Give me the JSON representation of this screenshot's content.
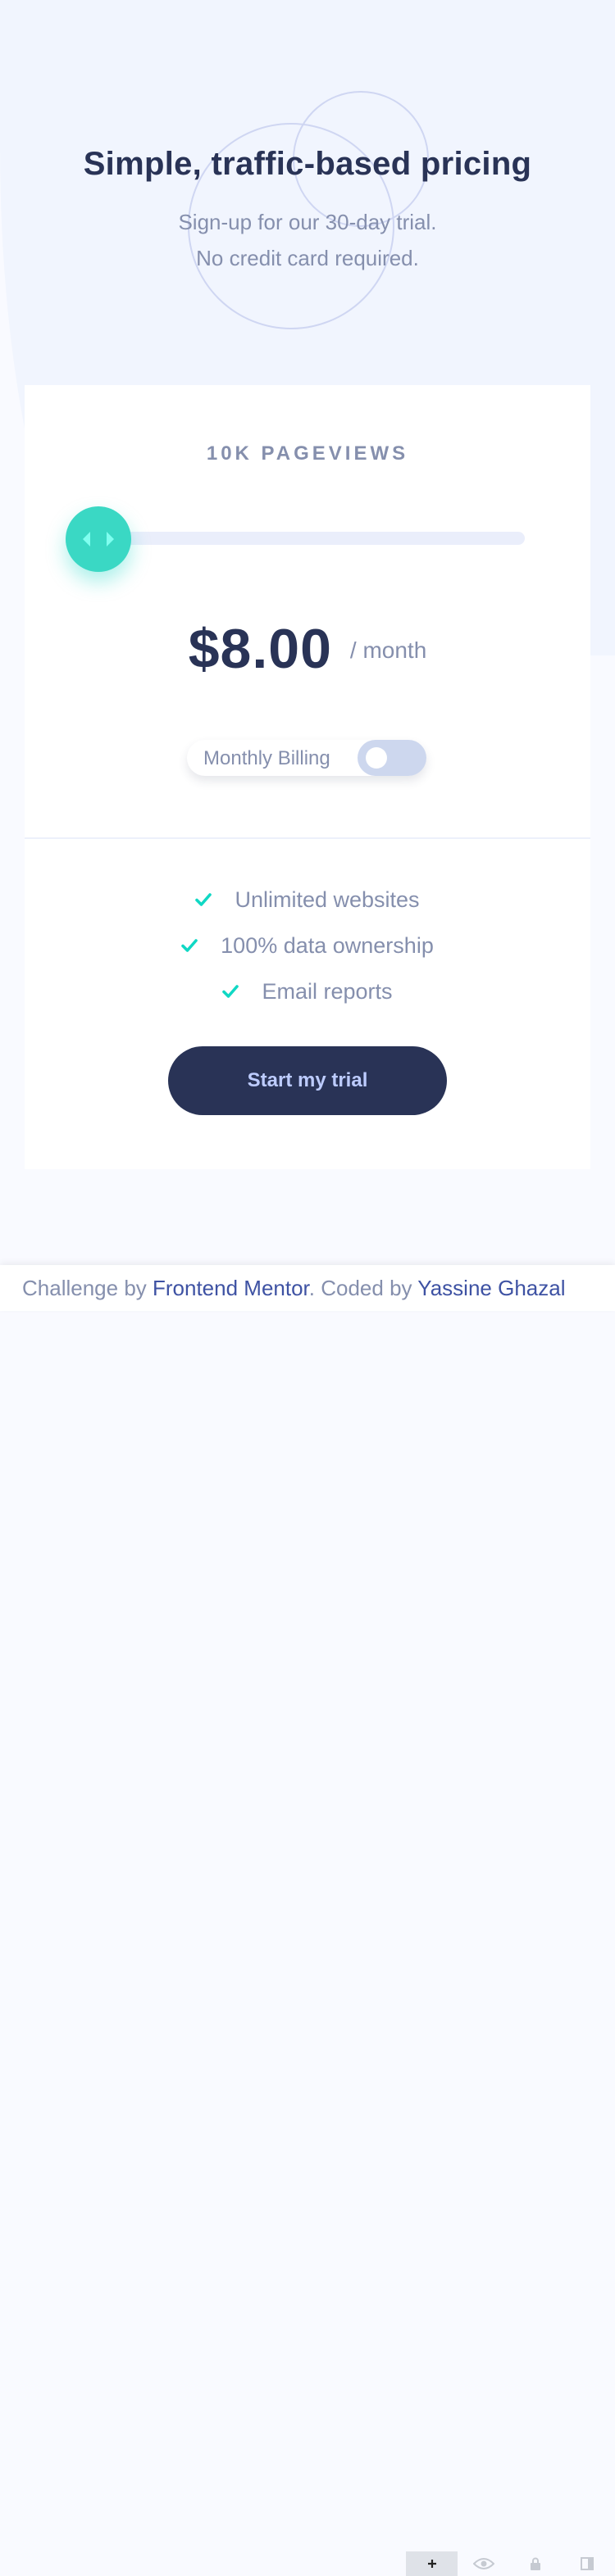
{
  "header": {
    "title": "Simple, traffic-based pricing",
    "subtitle_line1": "Sign-up for our 30-day trial.",
    "subtitle_line2": "No credit card required."
  },
  "card": {
    "pageviews": "10K PAGEVIEWS",
    "slider": {
      "level_percent": 0
    },
    "price": "$8.00",
    "period": "/ month",
    "billing": {
      "label": "Monthly Billing",
      "yearly_enabled": false
    },
    "features": [
      "Unlimited websites",
      "100% data ownership",
      "Email reports"
    ],
    "cta_label": "Start my trial"
  },
  "footer": {
    "prefix": "Challenge by ",
    "link1": "Frontend Mentor",
    "middle": ". Coded by ",
    "link2": "Yassine Ghazal"
  },
  "colors": {
    "accent": "#3ad8c4",
    "dark": "#293356",
    "text_muted": "#858fad",
    "toggle_bg": "#cdd7ee",
    "cta_text": "#bdccff"
  },
  "icons": {
    "slider_thumb": "arrows-left-right-icon",
    "feature_check": "check-icon",
    "devtools": [
      "add-icon",
      "eye-icon",
      "lock-icon",
      "panel-icon"
    ]
  }
}
